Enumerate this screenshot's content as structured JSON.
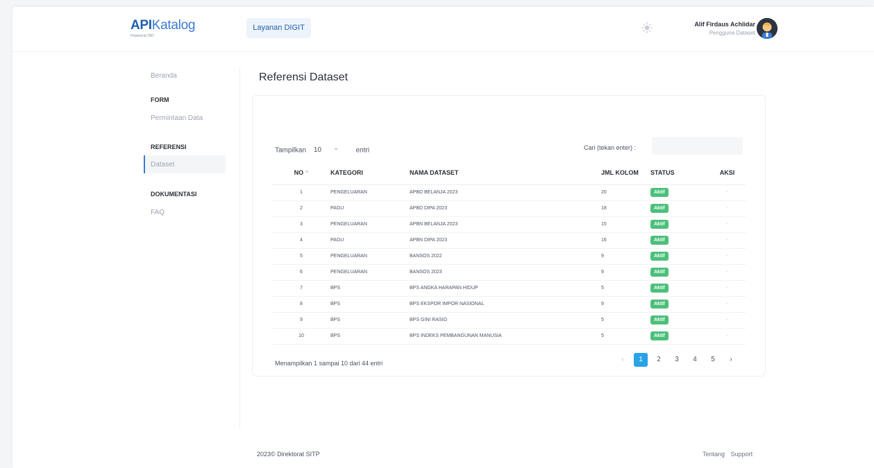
{
  "header": {
    "logo_bold": "API",
    "logo_rest": "Katalog",
    "logo_sub": "Powered by TBD",
    "service_button": "Layanan DIGIT",
    "theme_icon": "sun-icon",
    "user_name": "Alif Firdaus Achlidar",
    "user_role": "Pengguna Dataset"
  },
  "sidebar": {
    "home": "Beranda",
    "form_heading": "FORM",
    "form_item": "Permintaan Data",
    "ref_heading": "REFERENSI",
    "ref_item": "Dataset",
    "doc_heading": "DOKUMENTASI",
    "doc_item": "FAQ"
  },
  "main": {
    "title": "Referensi Dataset",
    "show_label": "Tampilkan",
    "show_value": "10",
    "show_suffix": "entri",
    "search_label": "Cari (tekan enter) :",
    "search_value": "",
    "columns": {
      "no": "NO",
      "kategori": "KATEGORI",
      "nama": "NAMA DATASET",
      "jml": "JML KOLOM",
      "status": "STATUS",
      "aksi": "AKSI"
    },
    "rows": [
      {
        "no": "1",
        "kategori": "PENGELUARAN",
        "nama": "APBD BELANJA 2023",
        "jml": "20",
        "status": "Aktif",
        "aksi": "-"
      },
      {
        "no": "2",
        "kategori": "PAGU",
        "nama": "APBD DIPA 2023",
        "jml": "18",
        "status": "Aktif",
        "aksi": "-"
      },
      {
        "no": "3",
        "kategori": "PENGELUARAN",
        "nama": "APBN BELANJA 2023",
        "jml": "15",
        "status": "Aktif",
        "aksi": "-"
      },
      {
        "no": "4",
        "kategori": "PAGU",
        "nama": "APBN DIPA 2023",
        "jml": "16",
        "status": "Aktif",
        "aksi": "-"
      },
      {
        "no": "5",
        "kategori": "PENGELUARAN",
        "nama": "BANSOS 2022",
        "jml": "9",
        "status": "Aktif",
        "aksi": "-"
      },
      {
        "no": "6",
        "kategori": "PENGELUARAN",
        "nama": "BANSOS 2023",
        "jml": "9",
        "status": "Aktif",
        "aksi": "-"
      },
      {
        "no": "7",
        "kategori": "BPS",
        "nama": "BPS ANGKA HARAPAN HIDUP",
        "jml": "5",
        "status": "Aktif",
        "aksi": "-"
      },
      {
        "no": "8",
        "kategori": "BPS",
        "nama": "BPS EKSPOR IMPOR NASIONAL",
        "jml": "9",
        "status": "Aktif",
        "aksi": "-"
      },
      {
        "no": "9",
        "kategori": "BPS",
        "nama": "BPS GINI RASIO",
        "jml": "5",
        "status": "Aktif",
        "aksi": "-"
      },
      {
        "no": "10",
        "kategori": "BPS",
        "nama": "BPS INDEKS PEMBANGUNAN MANUSIA",
        "jml": "5",
        "status": "Aktif",
        "aksi": "-"
      }
    ],
    "entries_info": "Menampilkan 1 sampai 10 dari 44 entri",
    "pagination": {
      "prev": "‹",
      "pages": [
        "1",
        "2",
        "3",
        "4",
        "5"
      ],
      "active": "1",
      "next": "›"
    }
  },
  "footer": {
    "copyright": "2023© Direktorat SITP",
    "link_about": "Tentang",
    "link_support": "Support"
  },
  "colors": {
    "brand": "#1f5fae",
    "accent": "#3a7bd5",
    "status_active": "#4bc07a",
    "page_active": "#29a3e6"
  }
}
